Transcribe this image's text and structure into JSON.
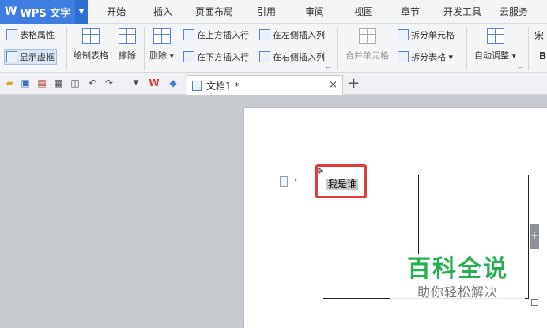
{
  "app": {
    "name": "WPS 文字",
    "logo": "W",
    "dropdown_icon": "caret-down-icon"
  },
  "menu": [
    "开始",
    "插入",
    "页面布局",
    "引用",
    "审阅",
    "视图",
    "章节",
    "开发工具",
    "云服务"
  ],
  "ribbon": {
    "table_properties": "表格属性",
    "show_gridlines": "显示虚框",
    "draw_table": "绘制表格",
    "eraser": "擦除",
    "delete": "删除",
    "insert_row_above": "在上方插入行",
    "insert_row_below": "在下方插入行",
    "insert_col_left": "在左侧插入列",
    "insert_col_right": "在右侧插入列",
    "merge_cells": "合并单元格",
    "split_cells": "拆分单元格",
    "split_table": "拆分表格",
    "auto_fit": "自动调整",
    "font_fragment": "宋",
    "bold_fragment": "B",
    "dropdown_arrow": "▾",
    "corner_mark": "⌐"
  },
  "quick_access": {
    "icons": [
      "folder-open-icon",
      "save-icon",
      "export-pdf-icon",
      "print-icon",
      "print-preview-icon",
      "undo-icon",
      "redo-icon",
      "customize-icon",
      "wps-logo-icon",
      "cloud-icon"
    ]
  },
  "doc_tab": {
    "title": "文档1 *",
    "close": "×",
    "new_tab": "+"
  },
  "document": {
    "cells": [
      [
        "我是谁",
        ""
      ],
      [
        "",
        ""
      ]
    ],
    "add_column": "+"
  },
  "watermark": {
    "title": "百科全说",
    "subtitle": "助你轻松解决"
  },
  "colors": {
    "accent": "#3d7ee0",
    "highlight_box": "#e03a3a",
    "watermark_green": "#23b14d"
  }
}
